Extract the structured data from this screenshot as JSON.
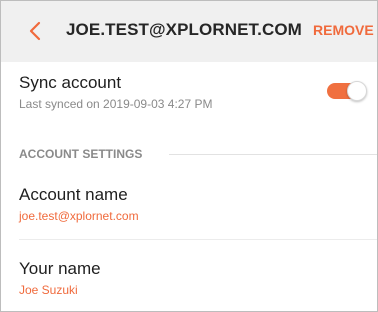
{
  "header": {
    "title": "JOE.TEST@XPLORNET.COM",
    "remove_label": "REMOVE",
    "back_icon": "chevron-left-icon"
  },
  "sync": {
    "title": "Sync account",
    "subtitle": "Last synced on 2019-09-03  4:27 PM",
    "enabled": true
  },
  "section": {
    "label": "ACCOUNT SETTINGS"
  },
  "settings": [
    {
      "title": "Account name",
      "value": "joe.test@xplornet.com"
    },
    {
      "title": "Your name",
      "value": "Joe Suzuki"
    }
  ],
  "colors": {
    "accent": "#f06a3c",
    "header_bg": "#f0f0f0",
    "text_primary": "#1f1f1f",
    "text_secondary": "#8a8a8a"
  }
}
